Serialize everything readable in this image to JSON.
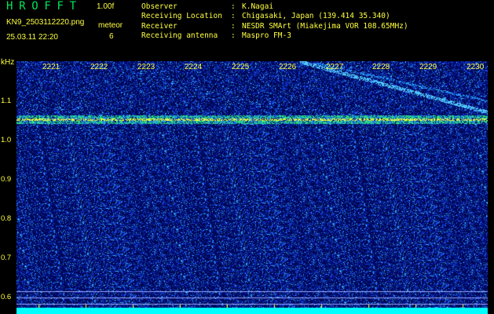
{
  "app": {
    "title": "HROFFT",
    "version": "1.00f",
    "filename": "KN9_2503112220.png",
    "timestamp": "25.03.11 22:20",
    "counter_label": "meteor",
    "counter_value": "6"
  },
  "info": [
    {
      "key": "Observer",
      "sep": ":",
      "value": "K.Nagai"
    },
    {
      "key": "Receiving Location",
      "sep": ":",
      "value": "Chigasaki, Japan (139.414 35.340)"
    },
    {
      "key": "Receiver",
      "sep": ":",
      "value": "NESDR SMArt (Miakejima VOR 108.65MHz)"
    },
    {
      "key": "Receiving antenna",
      "sep": ":",
      "value": "Maspro FM-3"
    }
  ],
  "axis": {
    "unit": "kHz",
    "y_ticks": [
      "1.1",
      "1.0",
      "0.9",
      "0.8",
      "0.7",
      "0.6"
    ],
    "x_ticks": [
      "2221",
      "2222",
      "2223",
      "2224",
      "2225",
      "2226",
      "2227",
      "2228",
      "2229",
      "2230"
    ]
  },
  "colors": {
    "background": "#000000",
    "text": "#ffff40",
    "title": "#00e85a",
    "noise": "#1a2cff",
    "carrier": "#ffff40",
    "bottom_band": "#00ffff"
  }
}
